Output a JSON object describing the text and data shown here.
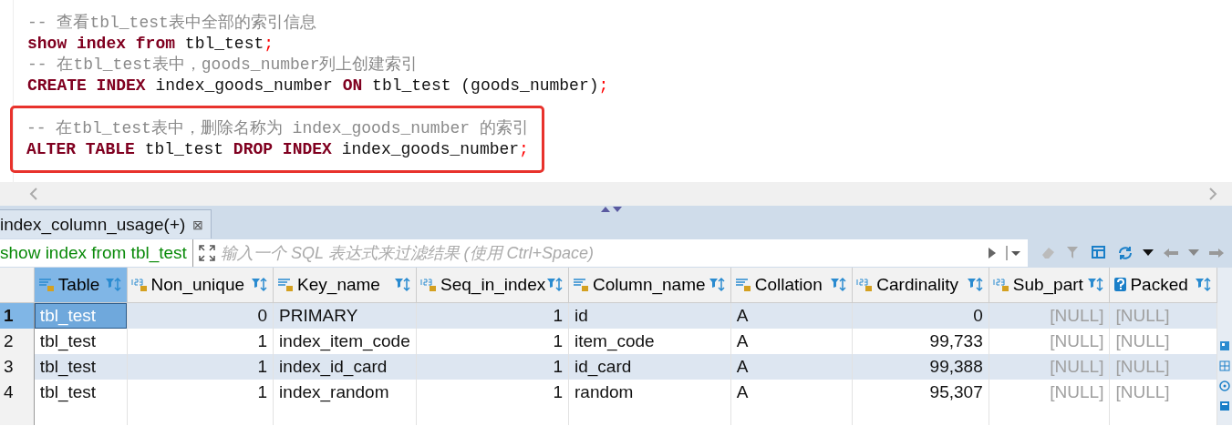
{
  "editor": {
    "blocks": [
      {
        "boxed": false,
        "lines": [
          [
            {
              "kind": "comment",
              "text": "-- 查看tbl_test表中全部的索引信息"
            }
          ],
          [
            {
              "kind": "keyword",
              "text": "show index from "
            },
            {
              "kind": "plain",
              "text": "tbl_test"
            },
            {
              "kind": "punct",
              "text": ";"
            }
          ],
          [
            {
              "kind": "comment",
              "text": "-- 在tbl_test表中，goods_number列上创建索引"
            }
          ],
          [
            {
              "kind": "keyword",
              "text": "CREATE INDEX "
            },
            {
              "kind": "plain",
              "text": "index_goods_number "
            },
            {
              "kind": "keyword",
              "text": "ON "
            },
            {
              "kind": "plain",
              "text": "tbl_test (goods_number)"
            },
            {
              "kind": "punct",
              "text": ";"
            }
          ]
        ]
      },
      {
        "boxed": true,
        "lines": [
          [
            {
              "kind": "comment",
              "text": "-- 在tbl_test表中，删除名称为 index_goods_number 的索引"
            }
          ],
          [
            {
              "kind": "keyword",
              "text": "ALTER TABLE "
            },
            {
              "kind": "plain",
              "text": "tbl_test "
            },
            {
              "kind": "keyword",
              "text": "DROP INDEX "
            },
            {
              "kind": "plain",
              "text": "index_goods_number"
            },
            {
              "kind": "punct",
              "text": ";"
            }
          ]
        ]
      }
    ]
  },
  "results_tab": {
    "label": "index_column_usage(+)",
    "close": "⊠"
  },
  "filter": {
    "query": "show index from tbl_test",
    "placeholder": "输入一个 SQL 表达式来过滤结果 (使用 Ctrl+Space)"
  },
  "grid": {
    "columns": [
      {
        "name": "Table",
        "kind": "text",
        "selected": true
      },
      {
        "name": "Non_unique",
        "kind": "number",
        "selected": false
      },
      {
        "name": "Key_name",
        "kind": "text",
        "selected": false
      },
      {
        "name": "Seq_in_index",
        "kind": "number",
        "selected": false
      },
      {
        "name": "Column_name",
        "kind": "text",
        "selected": false
      },
      {
        "name": "Collation",
        "kind": "text",
        "selected": false
      },
      {
        "name": "Cardinality",
        "kind": "number",
        "selected": false
      },
      {
        "name": "Sub_part",
        "kind": "number",
        "selected": false
      },
      {
        "name": "Packed",
        "kind": "unknown",
        "selected": false
      }
    ],
    "rows": [
      {
        "number": "1",
        "selected": true,
        "cells": [
          {
            "text": "tbl_test",
            "null": false
          },
          {
            "text": "0",
            "null": false
          },
          {
            "text": "PRIMARY",
            "null": false
          },
          {
            "text": "1",
            "null": false
          },
          {
            "text": "id",
            "null": false
          },
          {
            "text": "A",
            "null": false
          },
          {
            "text": "0",
            "null": false
          },
          {
            "text": "[NULL]",
            "null": true
          },
          {
            "text": "[NULL]",
            "null": true
          }
        ]
      },
      {
        "number": "2",
        "selected": false,
        "cells": [
          {
            "text": "tbl_test",
            "null": false
          },
          {
            "text": "1",
            "null": false
          },
          {
            "text": "index_item_code",
            "null": false
          },
          {
            "text": "1",
            "null": false
          },
          {
            "text": "item_code",
            "null": false
          },
          {
            "text": "A",
            "null": false
          },
          {
            "text": "99,733",
            "null": false
          },
          {
            "text": "[NULL]",
            "null": true
          },
          {
            "text": "[NULL]",
            "null": true
          }
        ]
      },
      {
        "number": "3",
        "selected": false,
        "cells": [
          {
            "text": "tbl_test",
            "null": false
          },
          {
            "text": "1",
            "null": false
          },
          {
            "text": "index_id_card",
            "null": false
          },
          {
            "text": "1",
            "null": false
          },
          {
            "text": "id_card",
            "null": false
          },
          {
            "text": "A",
            "null": false
          },
          {
            "text": "99,388",
            "null": false
          },
          {
            "text": "[NULL]",
            "null": true
          },
          {
            "text": "[NULL]",
            "null": true
          }
        ]
      },
      {
        "number": "4",
        "selected": false,
        "cells": [
          {
            "text": "tbl_test",
            "null": false
          },
          {
            "text": "1",
            "null": false
          },
          {
            "text": "index_random",
            "null": false
          },
          {
            "text": "1",
            "null": false
          },
          {
            "text": "random",
            "null": false
          },
          {
            "text": "A",
            "null": false
          },
          {
            "text": "95,307",
            "null": false
          },
          {
            "text": "[NULL]",
            "null": true
          },
          {
            "text": "[NULL]",
            "null": true
          }
        ]
      }
    ]
  }
}
